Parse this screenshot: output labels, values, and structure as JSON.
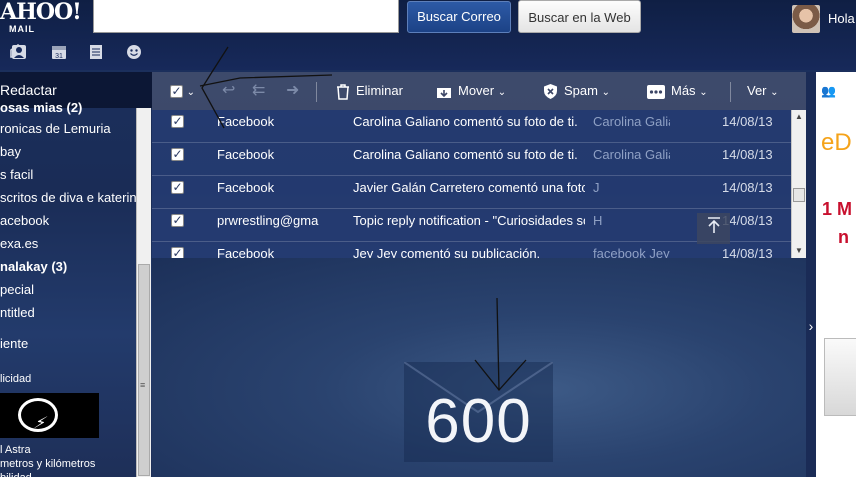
{
  "header": {
    "logo": "AHOO!",
    "logo_sub": "MAIL",
    "search_value": "",
    "search_mail_button": "Buscar Correo",
    "search_web_button": "Buscar en la Web",
    "greeting": "Hola",
    "app_icons": [
      "mail-icon",
      "contacts-icon",
      "calendar-icon",
      "notepad-icon",
      "messenger-icon"
    ]
  },
  "sidebar": {
    "compose": "Redactar",
    "folders": [
      {
        "label": "osas mias",
        "count": "(2)",
        "bold": true
      },
      {
        "label": "ronicas de Lemuria",
        "count": ""
      },
      {
        "label": "bay",
        "count": ""
      },
      {
        "label": "s facil",
        "count": ""
      },
      {
        "label": "scritos de diva e katerin",
        "count": ""
      },
      {
        "label": "acebook",
        "count": ""
      },
      {
        "label": "exa.es",
        "count": ""
      },
      {
        "label": "nalakay",
        "count": "(3)",
        "bold": true
      },
      {
        "label": "pecial",
        "count": ""
      },
      {
        "label": "ntitled",
        "count": ""
      },
      {
        "label": "iente",
        "count": ""
      }
    ],
    "ad_label": "licidad",
    "ad_lines": [
      "l Astra",
      "metros y kilómetros",
      "bilidad"
    ]
  },
  "toolbar": {
    "delete": "Eliminar",
    "move": "Mover",
    "spam": "Spam",
    "more": "Más",
    "view": "Ver"
  },
  "messages": [
    {
      "from": "Facebook",
      "subject": "Carolina Galiano comentó su foto de ti.",
      "snippet": "Carolina Galia",
      "date": "14/08/13",
      "checked": true
    },
    {
      "from": "Facebook",
      "subject": "Carolina Galiano comentó su foto de ti.",
      "snippet": "Carolina Galia",
      "date": "14/08/13",
      "checked": true
    },
    {
      "from": "Facebook",
      "subject": "Javier Galán Carretero comentó una foto que comp",
      "snippet": "J",
      "date": "14/08/13",
      "checked": true
    },
    {
      "from": "prwrestling@gma",
      "subject": "Topic reply notification - \"Curiosidades sobre algun",
      "snippet": "H",
      "date": "14/08/13",
      "checked": true
    },
    {
      "from": "Facebook",
      "subject": "Jey Jey comentó su publicación.",
      "snippet": "facebook Jey Jey com",
      "date": "14/08/13",
      "checked": true
    }
  ],
  "reading_pane": {
    "count": "600"
  },
  "right_ad": {
    "logo": "eD",
    "line1": "1 M",
    "line2": "n"
  },
  "colors": {
    "background": "#1c3160",
    "row": "#263e76",
    "primary_button": "#2d5aa6",
    "ad_red": "#c8102e"
  }
}
